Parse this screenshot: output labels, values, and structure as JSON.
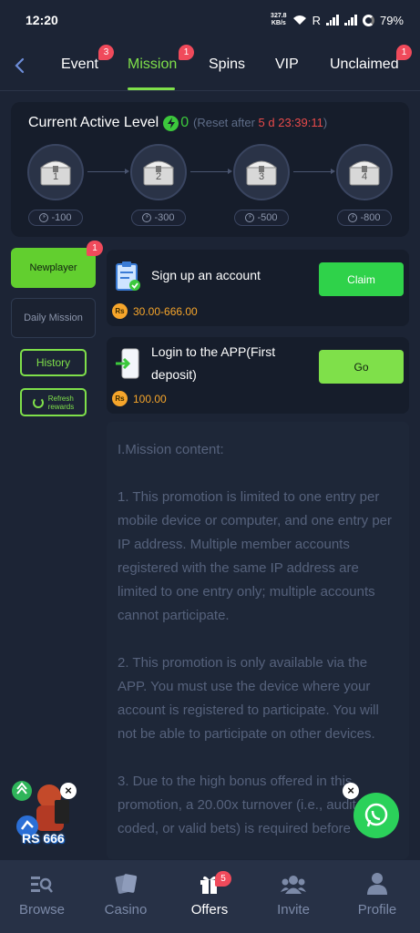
{
  "status_bar": {
    "time": "12:20",
    "net_speed_value": "327.8",
    "net_speed_unit": "KB/s",
    "roaming": "R",
    "battery": "79%"
  },
  "tabs": [
    {
      "label": "Event",
      "badge": "3"
    },
    {
      "label": "Mission",
      "badge": "1"
    },
    {
      "label": "Spins"
    },
    {
      "label": "VIP"
    },
    {
      "label": "Unclaimed",
      "badge": "1"
    }
  ],
  "level": {
    "title": "Current Active Level",
    "count": "0",
    "reset_prefix": "(Reset after ",
    "reset_time": "5 d 23:39:11",
    "reset_suffix": ")",
    "chests": [
      {
        "num": "1",
        "reward": "-100"
      },
      {
        "num": "2",
        "reward": "-300"
      },
      {
        "num": "3",
        "reward": "-500"
      },
      {
        "num": "4",
        "reward": "-800"
      }
    ]
  },
  "side_menu": {
    "newplayer": "Newplayer",
    "newplayer_badge": "1",
    "daily": "Daily Mission",
    "history": "History",
    "refresh_line1": "Refresh",
    "refresh_line2": "rewards"
  },
  "missions": [
    {
      "title": "Sign up an account",
      "reward": "30.00-666.00",
      "button": "Claim",
      "coin": "Rs"
    },
    {
      "title_line1": "Login to the APP(First",
      "title_line2": "deposit)",
      "reward": "100.00",
      "button": "Go",
      "coin": "Rs"
    }
  ],
  "content": {
    "heading": "I.Mission content:",
    "p1": "1. This promotion is limited to one entry per mobile device or computer, and one entry per IP address. Multiple member accounts registered with the same IP address are limited to one entry only; multiple accounts cannot participate.",
    "p2": "2. This promotion is only available via the APP. You must use the device where your account is registered to participate. You will not be able to participate on other devices.",
    "p3": "3. Due to the high bonus offered in this promotion, a 20.00x turnover (i.e., audit coded, or valid bets) is required before"
  },
  "promo": {
    "label": "RS 666"
  },
  "bottom_nav": [
    {
      "label": "Browse",
      "icon": "browse-icon"
    },
    {
      "label": "Casino",
      "icon": "casino-icon"
    },
    {
      "label": "Offers",
      "icon": "gift-icon",
      "badge": "5"
    },
    {
      "label": "Invite",
      "icon": "invite-icon"
    },
    {
      "label": "Profile",
      "icon": "profile-icon"
    }
  ],
  "colors": {
    "accent": "#7fe04a",
    "background": "#1c2435",
    "badge": "#f04a5b",
    "reward": "#f6a52b",
    "reset_time": "#e84a4a"
  }
}
